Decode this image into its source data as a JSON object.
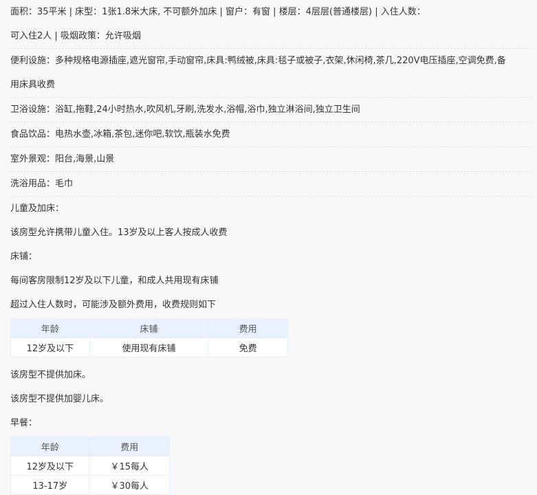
{
  "room_info": {
    "line1": "面积：35平米 | 床型：1张1.8米大床, 不可额外加床 | 窗户：有窗 | 楼层：4层层(普通楼层) | 入住人数：",
    "line2": "可入住2人 | 吸烟政策：允许吸烟"
  },
  "facilities": {
    "convenience_1": "便利设施：多种规格电源插座,遮光窗帘,手动窗帘,床具:鸭绒被,床具:毯子或被子,衣架,休闲椅,茶几,220V电压插座,空调免费,备",
    "convenience_2": "用床具收费",
    "bathroom": "卫浴设施：浴缸,拖鞋,24小时热水,吹风机,牙刷,洗发水,浴帽,浴巾,独立淋浴间,独立卫生间",
    "food": "食品饮品：电热水壶,冰箱,茶包,迷你吧,软饮,瓶装水免费",
    "view": "室外景观：阳台,海景,山景",
    "toiletries": "洗浴用品：毛巾"
  },
  "children": {
    "heading": "儿童及加床：",
    "policy": "该房型允许携带儿童入住。13岁及以上客人按成人收费",
    "bed_heading": "床铺：",
    "bed_limit": "每间客房限制12岁及以下儿童，和成人共用现有床铺",
    "bed_extra": "超过入住人数时，可能涉及额外费用，收费规则如下",
    "bed_table": {
      "headers": [
        "年龄",
        "床铺",
        "费用"
      ],
      "rows": [
        [
          "12岁及以下",
          "使用现有床铺",
          "免费"
        ]
      ]
    },
    "no_extra_bed": "该房型不提供加床。",
    "no_crib": "该房型不提供加婴儿床。"
  },
  "breakfast": {
    "heading": "早餐：",
    "table": {
      "headers": [
        "年龄",
        "费用"
      ],
      "rows": [
        [
          "12岁及以下",
          "￥15每人"
        ],
        [
          "13-17岁",
          "￥30每人"
        ]
      ]
    }
  },
  "colors": {
    "accent": "#3a8ee6",
    "table_header_bg": "#e8f1fd"
  }
}
